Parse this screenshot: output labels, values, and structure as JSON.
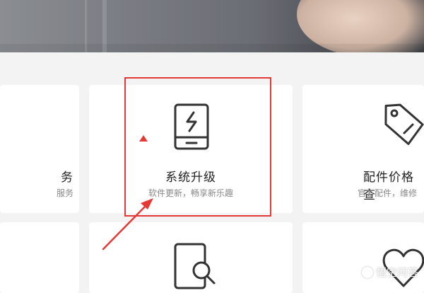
{
  "cards": [
    {
      "title": "务",
      "subtitle": "服务",
      "icon": "service-icon"
    },
    {
      "title": "系统升级",
      "subtitle": "软件更新，畅享新乐趣",
      "icon": "phone-bolt-icon"
    },
    {
      "title": "配件价格查",
      "subtitle": "官方配件，维修",
      "icon": "price-tag-icon"
    }
  ],
  "bottom_row_icons": [
    "phone-search-icon",
    "heart-icon"
  ],
  "annotation": {
    "color": "#e53935",
    "target": "系统升级"
  },
  "watermark": {
    "text": "悟空问答",
    "icon": "wukong-logo-icon"
  }
}
